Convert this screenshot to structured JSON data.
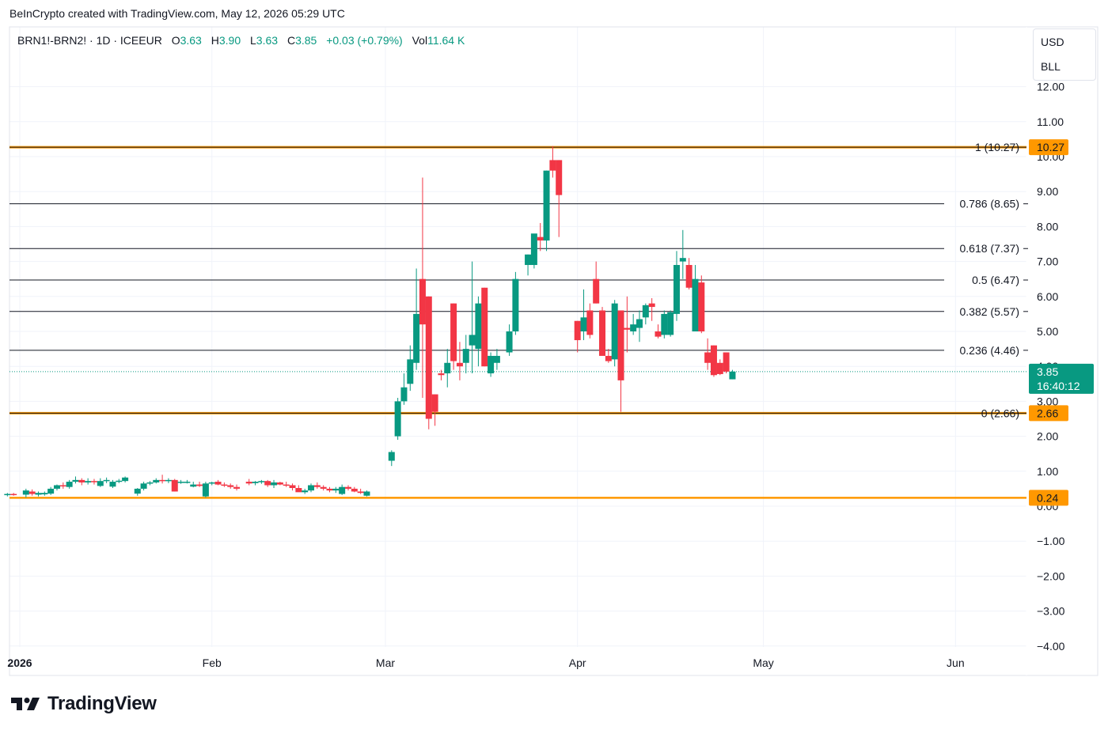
{
  "caption": "BeInCrypto created with TradingView.com, May 12, 2026 05:29 UTC",
  "legend": {
    "symbol": "BRN1!-BRN2! · 1D · ICEEUR",
    "o_label": "O",
    "o": "3.63",
    "h_label": "H",
    "h": "3.90",
    "l_label": "L",
    "l": "3.63",
    "c_label": "C",
    "c": "3.85",
    "change": "+0.03 (+0.79%)",
    "vol_label": "Vol",
    "vol": "11.64 K"
  },
  "units": {
    "currency": "USD",
    "unit": "BLL"
  },
  "brand": "TradingView",
  "colors": {
    "up": "#089981",
    "down": "#f23645",
    "fib_extreme": "#ff9800",
    "fib_line": "#131722",
    "grid": "#f0f3fa",
    "axis_text": "#131722"
  },
  "chart_data": {
    "type": "candlestick",
    "ylim": [
      -4,
      12
    ],
    "grid": true,
    "y_ticks": [
      "12.00",
      "11.00",
      "10.00",
      "9.00",
      "8.00",
      "7.00",
      "6.00",
      "5.00",
      "4.00",
      "3.00",
      "2.00",
      "1.00",
      "0.00",
      "−1.00",
      "−2.00",
      "−3.00",
      "−4.00"
    ],
    "y_tick_values": [
      12,
      11,
      10,
      9,
      8,
      7,
      6,
      5,
      4,
      3,
      2,
      1,
      0,
      -1,
      -2,
      -3,
      -4
    ],
    "x_ticks": [
      {
        "label": "2026",
        "day": 0
      },
      {
        "label": "Feb",
        "day": 31
      },
      {
        "label": "Mar",
        "day": 59
      },
      {
        "label": "Apr",
        "day": 90
      },
      {
        "label": "May",
        "day": 120
      },
      {
        "label": "Jun",
        "day": 151
      }
    ],
    "fib_levels": [
      {
        "ratio": "1",
        "value": 10.27,
        "label": "1 (10.27)",
        "tag": "10.27",
        "extreme": true
      },
      {
        "ratio": "0.786",
        "value": 8.65,
        "label": "0.786 (8.65)"
      },
      {
        "ratio": "0.618",
        "value": 7.37,
        "label": "0.618 (7.37)"
      },
      {
        "ratio": "0.5",
        "value": 6.47,
        "label": "0.5 (6.47)"
      },
      {
        "ratio": "0.382",
        "value": 5.57,
        "label": "0.382 (5.57)"
      },
      {
        "ratio": "0.236",
        "value": 4.46,
        "label": "0.236 (4.46)"
      },
      {
        "ratio": "0",
        "value": 2.66,
        "label": "0 (2.66)",
        "tag": "2.66",
        "extreme": true
      }
    ],
    "support_line": {
      "value": 0.24,
      "tag": "0.24"
    },
    "last_price": {
      "value": 3.85,
      "tag": "3.85",
      "countdown": "16:40:12"
    },
    "candles": [
      {
        "d": -2,
        "o": 0.32,
        "h": 0.38,
        "l": 0.28,
        "c": 0.35
      },
      {
        "d": -1,
        "o": 0.35,
        "h": 0.38,
        "l": 0.3,
        "c": 0.33
      },
      {
        "d": 1,
        "o": 0.33,
        "h": 0.5,
        "l": 0.25,
        "c": 0.45
      },
      {
        "d": 2,
        "o": 0.42,
        "h": 0.48,
        "l": 0.3,
        "c": 0.35
      },
      {
        "d": 3,
        "o": 0.33,
        "h": 0.42,
        "l": 0.28,
        "c": 0.38
      },
      {
        "d": 4,
        "o": 0.34,
        "h": 0.42,
        "l": 0.3,
        "c": 0.38
      },
      {
        "d": 5,
        "o": 0.36,
        "h": 0.55,
        "l": 0.32,
        "c": 0.5
      },
      {
        "d": 6,
        "o": 0.5,
        "h": 0.62,
        "l": 0.45,
        "c": 0.6
      },
      {
        "d": 7,
        "o": 0.6,
        "h": 0.68,
        "l": 0.5,
        "c": 0.58
      },
      {
        "d": 8,
        "o": 0.55,
        "h": 0.75,
        "l": 0.5,
        "c": 0.7
      },
      {
        "d": 9,
        "o": 0.7,
        "h": 0.85,
        "l": 0.65,
        "c": 0.75
      },
      {
        "d": 10,
        "o": 0.75,
        "h": 0.8,
        "l": 0.6,
        "c": 0.68
      },
      {
        "d": 11,
        "o": 0.68,
        "h": 0.8,
        "l": 0.62,
        "c": 0.72
      },
      {
        "d": 12,
        "o": 0.72,
        "h": 0.78,
        "l": 0.62,
        "c": 0.7
      },
      {
        "d": 13,
        "o": 0.58,
        "h": 0.8,
        "l": 0.55,
        "c": 0.72
      },
      {
        "d": 14,
        "o": 0.72,
        "h": 0.82,
        "l": 0.66,
        "c": 0.75
      },
      {
        "d": 15,
        "o": 0.56,
        "h": 0.75,
        "l": 0.52,
        "c": 0.7
      },
      {
        "d": 16,
        "o": 0.7,
        "h": 0.78,
        "l": 0.66,
        "c": 0.73
      },
      {
        "d": 17,
        "o": 0.72,
        "h": 0.85,
        "l": 0.68,
        "c": 0.82
      },
      {
        "d": 19,
        "o": 0.36,
        "h": 0.52,
        "l": 0.3,
        "c": 0.5
      },
      {
        "d": 20,
        "o": 0.5,
        "h": 0.7,
        "l": 0.45,
        "c": 0.65
      },
      {
        "d": 21,
        "o": 0.65,
        "h": 0.72,
        "l": 0.6,
        "c": 0.68
      },
      {
        "d": 22,
        "o": 0.68,
        "h": 0.8,
        "l": 0.65,
        "c": 0.75
      },
      {
        "d": 23,
        "o": 0.75,
        "h": 0.9,
        "l": 0.65,
        "c": 0.72
      },
      {
        "d": 24,
        "o": 0.72,
        "h": 0.8,
        "l": 0.66,
        "c": 0.75
      },
      {
        "d": 25,
        "o": 0.75,
        "h": 0.78,
        "l": 0.42,
        "c": 0.42
      },
      {
        "d": 26,
        "o": 0.68,
        "h": 0.75,
        "l": 0.64,
        "c": 0.7
      },
      {
        "d": 27,
        "o": 0.7,
        "h": 0.75,
        "l": 0.65,
        "c": 0.7
      },
      {
        "d": 28,
        "o": 0.56,
        "h": 0.7,
        "l": 0.54,
        "c": 0.62
      },
      {
        "d": 29,
        "o": 0.62,
        "h": 0.7,
        "l": 0.55,
        "c": 0.58
      },
      {
        "d": 30,
        "o": 0.28,
        "h": 0.7,
        "l": 0.25,
        "c": 0.65
      },
      {
        "d": 31,
        "o": 0.65,
        "h": 0.7,
        "l": 0.6,
        "c": 0.68
      },
      {
        "d": 32,
        "o": 0.7,
        "h": 0.75,
        "l": 0.6,
        "c": 0.62
      },
      {
        "d": 33,
        "o": 0.62,
        "h": 0.68,
        "l": 0.55,
        "c": 0.6
      },
      {
        "d": 34,
        "o": 0.6,
        "h": 0.65,
        "l": 0.5,
        "c": 0.55
      },
      {
        "d": 35,
        "o": 0.55,
        "h": 0.62,
        "l": 0.45,
        "c": 0.5
      },
      {
        "d": 37,
        "o": 0.7,
        "h": 0.78,
        "l": 0.6,
        "c": 0.65
      },
      {
        "d": 38,
        "o": 0.66,
        "h": 0.72,
        "l": 0.6,
        "c": 0.7
      },
      {
        "d": 39,
        "o": 0.7,
        "h": 0.75,
        "l": 0.64,
        "c": 0.72
      },
      {
        "d": 40,
        "o": 0.72,
        "h": 0.75,
        "l": 0.55,
        "c": 0.6
      },
      {
        "d": 41,
        "o": 0.6,
        "h": 0.75,
        "l": 0.52,
        "c": 0.68
      },
      {
        "d": 42,
        "o": 0.68,
        "h": 0.7,
        "l": 0.6,
        "c": 0.62
      },
      {
        "d": 43,
        "o": 0.62,
        "h": 0.7,
        "l": 0.55,
        "c": 0.6
      },
      {
        "d": 44,
        "o": 0.6,
        "h": 0.65,
        "l": 0.45,
        "c": 0.52
      },
      {
        "d": 45,
        "o": 0.52,
        "h": 0.6,
        "l": 0.42,
        "c": 0.4
      },
      {
        "d": 46,
        "o": 0.4,
        "h": 0.5,
        "l": 0.35,
        "c": 0.45
      },
      {
        "d": 47,
        "o": 0.45,
        "h": 0.65,
        "l": 0.4,
        "c": 0.6
      },
      {
        "d": 48,
        "o": 0.6,
        "h": 0.68,
        "l": 0.5,
        "c": 0.55
      },
      {
        "d": 49,
        "o": 0.55,
        "h": 0.6,
        "l": 0.45,
        "c": 0.5
      },
      {
        "d": 50,
        "o": 0.5,
        "h": 0.55,
        "l": 0.4,
        "c": 0.45
      },
      {
        "d": 51,
        "o": 0.45,
        "h": 0.55,
        "l": 0.38,
        "c": 0.5
      },
      {
        "d": 52,
        "o": 0.35,
        "h": 0.62,
        "l": 0.32,
        "c": 0.55
      },
      {
        "d": 53,
        "o": 0.55,
        "h": 0.6,
        "l": 0.45,
        "c": 0.5
      },
      {
        "d": 54,
        "o": 0.5,
        "h": 0.55,
        "l": 0.4,
        "c": 0.42
      },
      {
        "d": 55,
        "o": 0.42,
        "h": 0.5,
        "l": 0.35,
        "c": 0.38
      },
      {
        "d": 56,
        "o": 0.3,
        "h": 0.45,
        "l": 0.28,
        "c": 0.42
      },
      {
        "d": 60,
        "o": 1.3,
        "h": 1.6,
        "l": 1.15,
        "c": 1.55
      },
      {
        "d": 61,
        "o": 2.0,
        "h": 3.1,
        "l": 1.9,
        "c": 3.0
      },
      {
        "d": 62,
        "o": 3.0,
        "h": 3.8,
        "l": 2.9,
        "c": 3.4
      },
      {
        "d": 63,
        "o": 3.5,
        "h": 4.6,
        "l": 3.3,
        "c": 4.2
      },
      {
        "d": 64,
        "o": 4.1,
        "h": 6.8,
        "l": 3.9,
        "c": 5.5
      },
      {
        "d": 65,
        "o": 6.5,
        "h": 9.4,
        "l": 3.1,
        "c": 5.2
      },
      {
        "d": 66,
        "o": 6.0,
        "h": 6.0,
        "l": 2.2,
        "c": 2.5
      },
      {
        "d": 67,
        "o": 3.2,
        "h": 3.2,
        "l": 2.3,
        "c": 2.7
      },
      {
        "d": 68,
        "o": 3.8,
        "h": 3.9,
        "l": 3.6,
        "c": 3.75
      },
      {
        "d": 69,
        "o": 3.8,
        "h": 4.5,
        "l": 3.4,
        "c": 4.1
      },
      {
        "d": 70,
        "o": 5.8,
        "h": 5.8,
        "l": 3.9,
        "c": 4.15
      },
      {
        "d": 71,
        "o": 4.1,
        "h": 4.7,
        "l": 3.6,
        "c": 4.0
      },
      {
        "d": 72,
        "o": 4.1,
        "h": 4.9,
        "l": 3.8,
        "c": 4.5
      },
      {
        "d": 73,
        "o": 4.6,
        "h": 7.0,
        "l": 3.8,
        "c": 4.9
      },
      {
        "d": 74,
        "o": 4.5,
        "h": 6.0,
        "l": 4.0,
        "c": 5.8
      },
      {
        "d": 75,
        "o": 6.25,
        "h": 6.25,
        "l": 4.0,
        "c": 4.0
      },
      {
        "d": 76,
        "o": 3.8,
        "h": 4.4,
        "l": 3.7,
        "c": 4.3
      },
      {
        "d": 77,
        "o": 4.1,
        "h": 4.5,
        "l": 3.9,
        "c": 4.3
      },
      {
        "d": 79,
        "o": 4.4,
        "h": 5.2,
        "l": 4.3,
        "c": 5.0
      },
      {
        "d": 80,
        "o": 5.0,
        "h": 6.7,
        "l": 4.9,
        "c": 6.5
      },
      {
        "d": 82,
        "o": 6.9,
        "h": 7.2,
        "l": 6.6,
        "c": 7.2
      },
      {
        "d": 83,
        "o": 6.9,
        "h": 7.6,
        "l": 6.8,
        "c": 7.8
      },
      {
        "d": 84,
        "o": 7.7,
        "h": 8.1,
        "l": 7.3,
        "c": 7.6
      },
      {
        "d": 85,
        "o": 7.6,
        "h": 9.6,
        "l": 7.3,
        "c": 9.6
      },
      {
        "d": 86,
        "o": 9.9,
        "h": 10.3,
        "l": 9.4,
        "c": 9.6
      },
      {
        "d": 87,
        "o": 9.9,
        "h": 9.9,
        "l": 7.7,
        "c": 8.9
      },
      {
        "d": 90,
        "o": 5.3,
        "h": 5.3,
        "l": 4.4,
        "c": 4.75
      },
      {
        "d": 91,
        "o": 5.0,
        "h": 6.2,
        "l": 4.75,
        "c": 5.4
      },
      {
        "d": 92,
        "o": 5.6,
        "h": 5.8,
        "l": 4.8,
        "c": 4.9
      },
      {
        "d": 93,
        "o": 6.5,
        "h": 7.0,
        "l": 5.8,
        "c": 5.8
      },
      {
        "d": 94,
        "o": 5.6,
        "h": 5.7,
        "l": 4.5,
        "c": 4.3
      },
      {
        "d": 95,
        "o": 4.3,
        "h": 4.5,
        "l": 4.1,
        "c": 4.15
      },
      {
        "d": 96,
        "o": 4.2,
        "h": 5.9,
        "l": 4.0,
        "c": 5.8
      },
      {
        "d": 97,
        "o": 5.6,
        "h": 5.6,
        "l": 2.7,
        "c": 3.6
      },
      {
        "d": 98,
        "o": 5.1,
        "h": 6.0,
        "l": 4.4,
        "c": 5.05
      },
      {
        "d": 99,
        "o": 5.0,
        "h": 5.5,
        "l": 4.9,
        "c": 5.2
      },
      {
        "d": 100,
        "o": 5.1,
        "h": 5.6,
        "l": 4.7,
        "c": 5.35
      },
      {
        "d": 101,
        "o": 5.4,
        "h": 5.8,
        "l": 5.2,
        "c": 5.75
      },
      {
        "d": 102,
        "o": 5.8,
        "h": 5.95,
        "l": 5.3,
        "c": 5.7
      },
      {
        "d": 103,
        "o": 5.0,
        "h": 5.2,
        "l": 4.8,
        "c": 4.85
      },
      {
        "d": 104,
        "o": 4.9,
        "h": 5.6,
        "l": 4.8,
        "c": 5.5
      },
      {
        "d": 105,
        "o": 4.9,
        "h": 5.6,
        "l": 4.85,
        "c": 5.55
      },
      {
        "d": 106,
        "o": 5.5,
        "h": 7.3,
        "l": 5.3,
        "c": 6.9
      },
      {
        "d": 107,
        "o": 7.0,
        "h": 7.9,
        "l": 6.5,
        "c": 7.1
      },
      {
        "d": 108,
        "o": 6.9,
        "h": 7.1,
        "l": 6.2,
        "c": 6.25
      },
      {
        "d": 109,
        "o": 5.0,
        "h": 6.9,
        "l": 5.0,
        "c": 6.5
      },
      {
        "d": 110,
        "o": 6.4,
        "h": 6.6,
        "l": 4.95,
        "c": 5.0
      },
      {
        "d": 111,
        "o": 4.4,
        "h": 4.8,
        "l": 3.9,
        "c": 4.1
      },
      {
        "d": 112,
        "o": 4.6,
        "h": 4.6,
        "l": 3.7,
        "c": 3.75
      },
      {
        "d": 113,
        "o": 4.1,
        "h": 4.2,
        "l": 3.75,
        "c": 3.78
      },
      {
        "d": 114,
        "o": 4.4,
        "h": 4.4,
        "l": 3.8,
        "c": 3.85
      },
      {
        "d": 115,
        "o": 3.63,
        "h": 3.9,
        "l": 3.63,
        "c": 3.85
      }
    ]
  }
}
